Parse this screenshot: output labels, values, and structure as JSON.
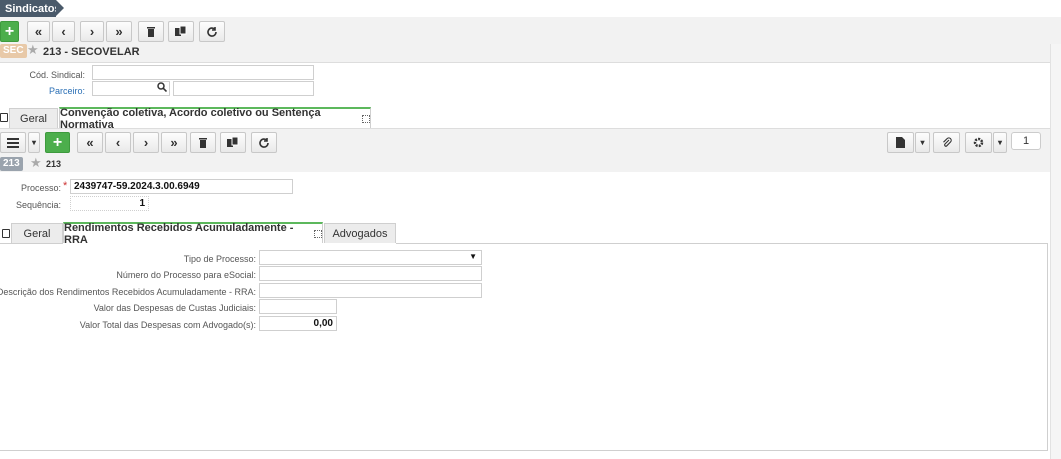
{
  "app": {
    "title": "Sindicatos"
  },
  "record": {
    "badge": "SEC",
    "title": "213 - SECOVELAR"
  },
  "fields": {
    "cod_sindical": {
      "label": "Cód. Sindical:",
      "value": ""
    },
    "parceiro": {
      "label": "Parceiro:",
      "value": "",
      "desc": ""
    }
  },
  "tabs_main": [
    {
      "label": "Geral"
    },
    {
      "label": "Convenção coletiva, Acordo coletivo ou Sentença Normativa"
    }
  ],
  "sub_record": {
    "badge": "213",
    "title": "213",
    "counter": "1"
  },
  "sub_fields": {
    "processo": {
      "label": "Processo:",
      "required": "*",
      "value": "2439747-59.2024.3.00.6949"
    },
    "sequencia": {
      "label": "Sequência:",
      "value": "1"
    }
  },
  "tabs_sub": [
    {
      "label": "Geral"
    },
    {
      "label": "Rendimentos Recebidos Acumuladamente - RRA"
    },
    {
      "label": "Advogados"
    }
  ],
  "rra": {
    "tipo_processo": {
      "label": "Tipo de Processo:",
      "value": ""
    },
    "numero_processo": {
      "label": "Número do Processo para eSocial:",
      "value": ""
    },
    "descricao": {
      "label": "Descrição dos Rendimentos Recebidos Acumuladamente - RRA:",
      "value": ""
    },
    "valor_custas": {
      "label": "Valor das Despesas de Custas Judiciais:",
      "value": ""
    },
    "valor_advogados": {
      "label": "Valor Total das Despesas com Advogado(s):",
      "value": "0,00"
    }
  },
  "colors": {
    "accent": "#5cb85c",
    "title_bar": "#4a5a6a",
    "record_badge": "#e8c9a8",
    "sub_badge": "#9aa3ad"
  }
}
